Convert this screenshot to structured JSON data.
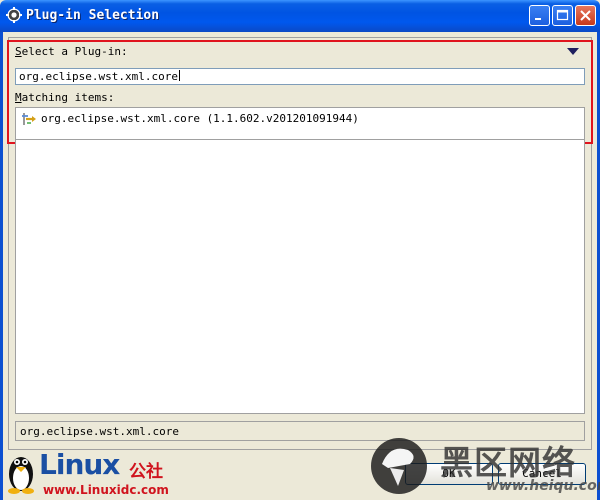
{
  "window": {
    "title": "Plug-in Selection"
  },
  "dialog": {
    "select_label": "Select a Plug-in:",
    "select_mnemonic": "S",
    "select_rest": "elect a Plug-in:",
    "filter_value": "org.eclipse.wst.xml.core",
    "matching_label": "Matching items:",
    "matching_mnemonic": "M",
    "matching_rest": "atching items:",
    "items": [
      {
        "label": "org.eclipse.wst.xml.core (1.1.602.v201201091944)",
        "icon": "plugin-icon"
      }
    ],
    "status": "org.eclipse.wst.xml.core"
  },
  "buttons": {
    "ok": "OK",
    "cancel": "Cancel"
  },
  "watermarks": {
    "left_brand": "Linux",
    "left_brand_cn": "公社",
    "left_url": "www.Linuxidc.com",
    "right_brand": "黑区网络",
    "right_url": "www.heiqu.com"
  },
  "colors": {
    "titlebar": "#0054e3",
    "highlight_border": "#e0141e",
    "background": "#ece9d8"
  }
}
